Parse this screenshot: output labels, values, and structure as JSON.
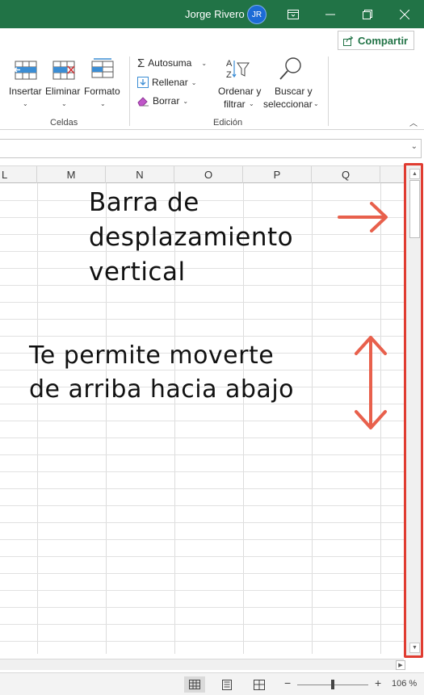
{
  "window": {
    "user_name": "Jorge Rivero",
    "user_initials": "JR",
    "title_bar_color": "#217346"
  },
  "share": {
    "label": "Compartir",
    "icon": "share-icon"
  },
  "ribbon": {
    "cells_group": {
      "label": "Celdas",
      "buttons": [
        {
          "label": "Insertar",
          "icon": "insert-cells-icon"
        },
        {
          "label": "Eliminar",
          "icon": "delete-cells-icon"
        },
        {
          "label": "Formato",
          "icon": "format-cells-icon"
        }
      ]
    },
    "edit_group": {
      "label": "Edición",
      "autosum": "Autosuma",
      "fill": "Rellenar",
      "clear": "Borrar",
      "sort_line1": "Ordenar y",
      "sort_line2": "filtrar",
      "find_line1": "Buscar y",
      "find_line2": "seleccionar"
    }
  },
  "columns": [
    "L",
    "M",
    "N",
    "O",
    "P",
    "Q"
  ],
  "annotations": {
    "top_line1": "Barra de",
    "top_line2": "desplazamiento",
    "top_line3": "vertical",
    "bottom_line1": "Te permite moverte",
    "bottom_line2": "de arriba hacia abajo",
    "arrow_color": "#e8604c",
    "highlight_color": "#e03c31"
  },
  "status": {
    "zoom_level": "106 %",
    "zoom_minus": "−",
    "zoom_plus": "+",
    "zoom_fraction": 0.54
  }
}
